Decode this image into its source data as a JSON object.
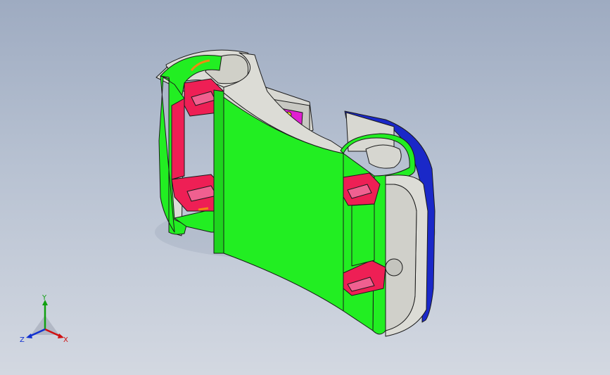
{
  "scene": {
    "model_name": "",
    "colors": {
      "background_top": "#9eabc1",
      "background_bottom": "#d3d8e1",
      "section_face": "#22ee22",
      "inner_ribs": "#ee1f55",
      "body_surface": "#dcdcd6",
      "edge_outline": "#1a1a1a",
      "blue_cap": "#1a28c8",
      "magenta_part": "#e020d0",
      "yellow_detail": "#f0e020",
      "orange_detail": "#f08a10"
    }
  },
  "triad": {
    "x_label": "X",
    "y_label": "Y",
    "z_label": "Z",
    "colors": {
      "x": "#d01010",
      "y": "#10a010",
      "z": "#1030d0"
    }
  }
}
